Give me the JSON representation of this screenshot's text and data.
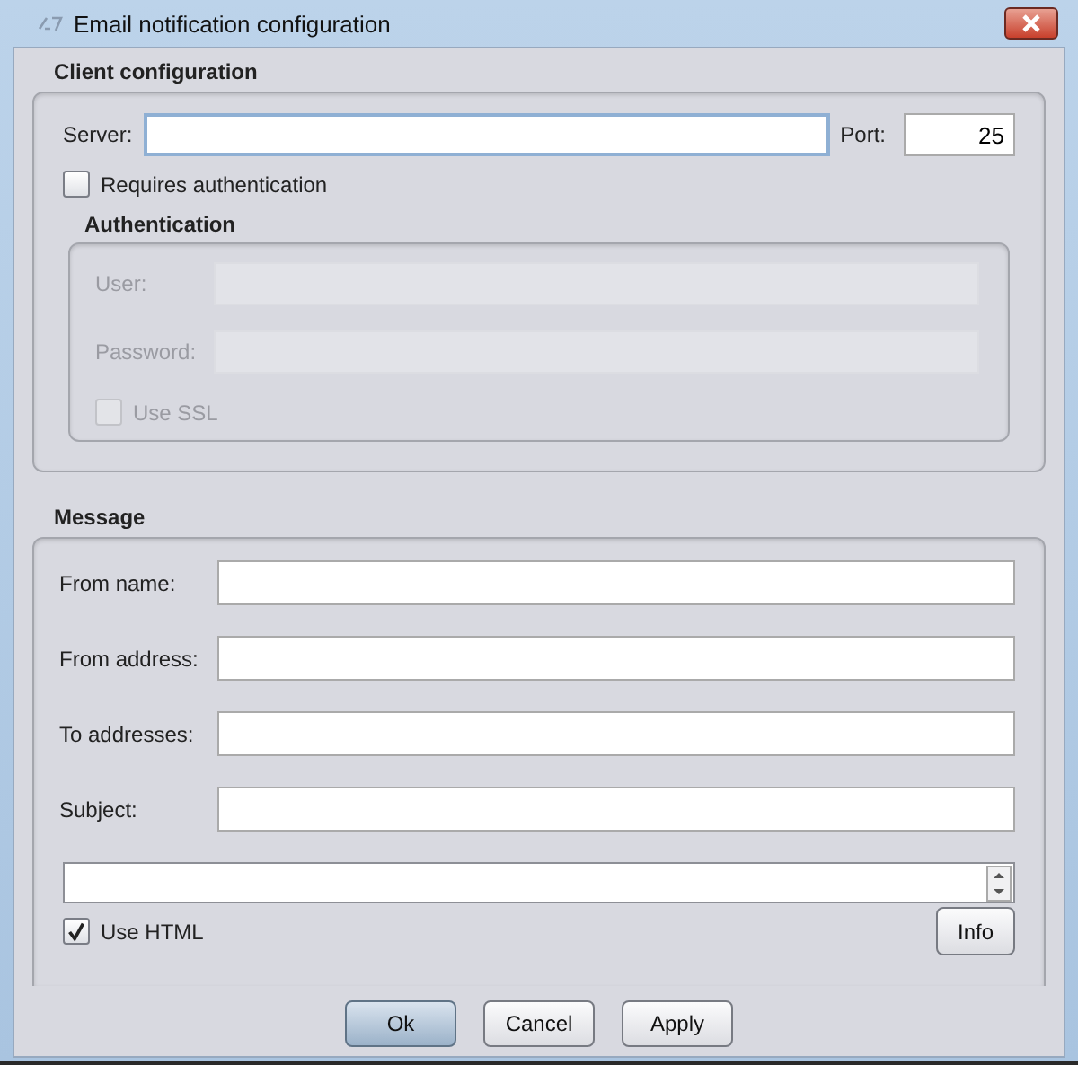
{
  "window": {
    "title": "Email notification configuration"
  },
  "client_configuration": {
    "heading": "Client configuration",
    "server": {
      "label": "Server:",
      "focused": true
    },
    "port": {
      "label": "Port:",
      "value": "25"
    },
    "requires_authentication": {
      "label": "Requires authentication",
      "checked": false
    },
    "authentication": {
      "heading": "Authentication",
      "disabled": true,
      "fields": [
        {
          "label": "User:"
        },
        {
          "label": "Password:"
        }
      ],
      "use_ssl": {
        "label": "Use SSL",
        "checked": false
      }
    }
  },
  "message": {
    "heading": "Message",
    "fields": [
      {
        "label": "From name:"
      },
      {
        "label": "From address:"
      },
      {
        "label": "To addresses:"
      },
      {
        "label": "Subject:"
      }
    ],
    "use_html": {
      "label": "Use HTML",
      "checked": true
    },
    "info_button": "Info"
  },
  "buttons": [
    {
      "label": "Ok",
      "selected": true
    },
    {
      "label": "Cancel",
      "selected": false
    },
    {
      "label": "Apply",
      "selected": false
    }
  ]
}
